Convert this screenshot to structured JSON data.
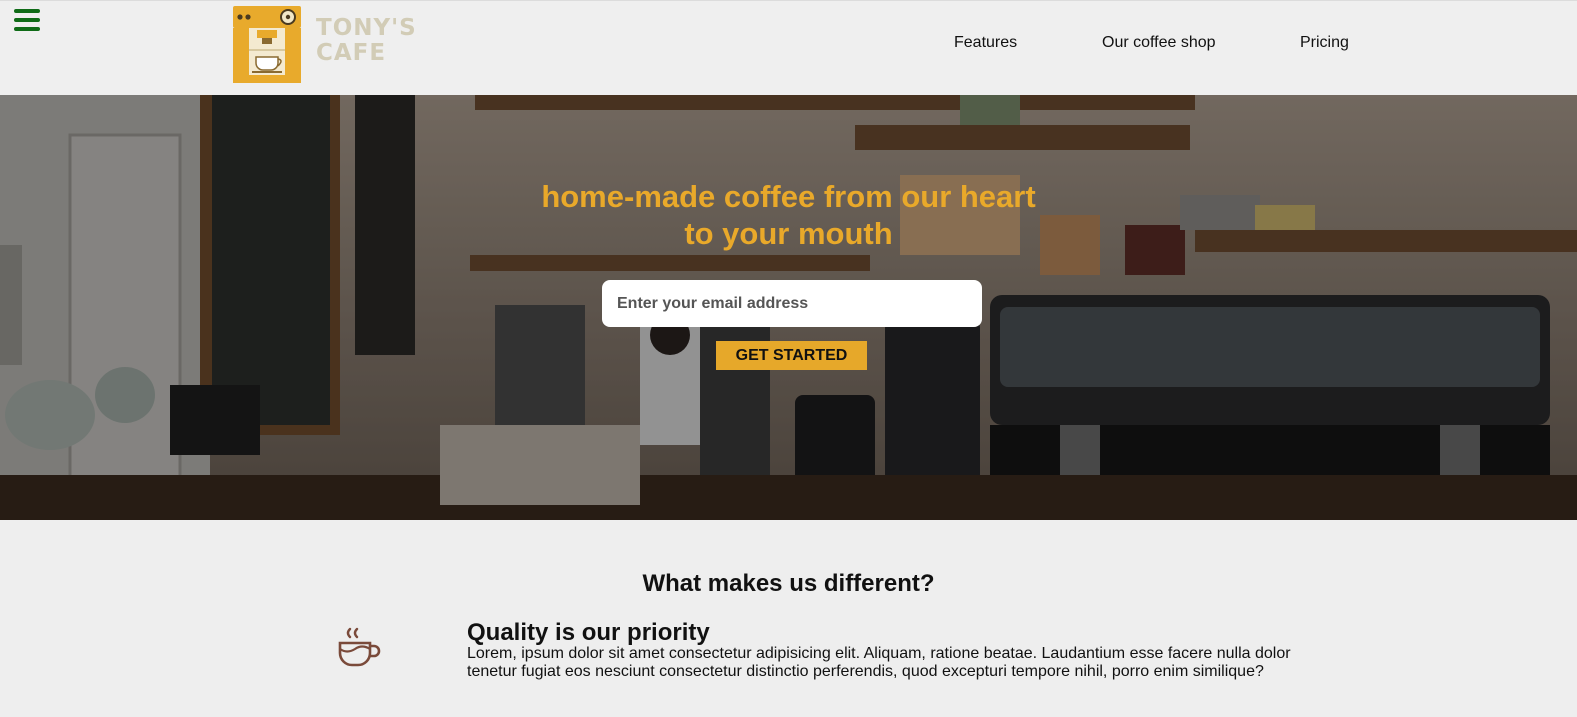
{
  "header": {
    "menu_icon": "hamburger-menu-icon",
    "logo_icon": "coffee-machine-icon",
    "logo_line1": "TONY'S",
    "logo_line2": "CAFE",
    "nav": [
      "Features",
      "Our coffee shop",
      "Pricing"
    ]
  },
  "hero": {
    "title_line1": "home-made coffee from our heart",
    "title_line2": "to your mouth",
    "email_placeholder": "Enter your email address",
    "cta_label": "GET STARTED"
  },
  "features": {
    "section_title": "What makes us different?",
    "items": [
      {
        "icon": "coffee-cup-icon",
        "heading": "Quality is our priority",
        "text": "Lorem, ipsum dolor sit amet consectetur adipisicing elit. Aliquam, ratione beatae. Laudantium esse facere nulla dolor tenetur fugiat eos nesciunt consectetur distinctio perferendis, quod excepturi tempore nihil, porro enim similique?"
      }
    ]
  },
  "colors": {
    "accent": "#e6a82a",
    "menu_icon": "#0f6b17",
    "logo_text": "#d2ccb6",
    "page_background": "#eeeeee",
    "feature_icon": "#7a4a3a"
  }
}
